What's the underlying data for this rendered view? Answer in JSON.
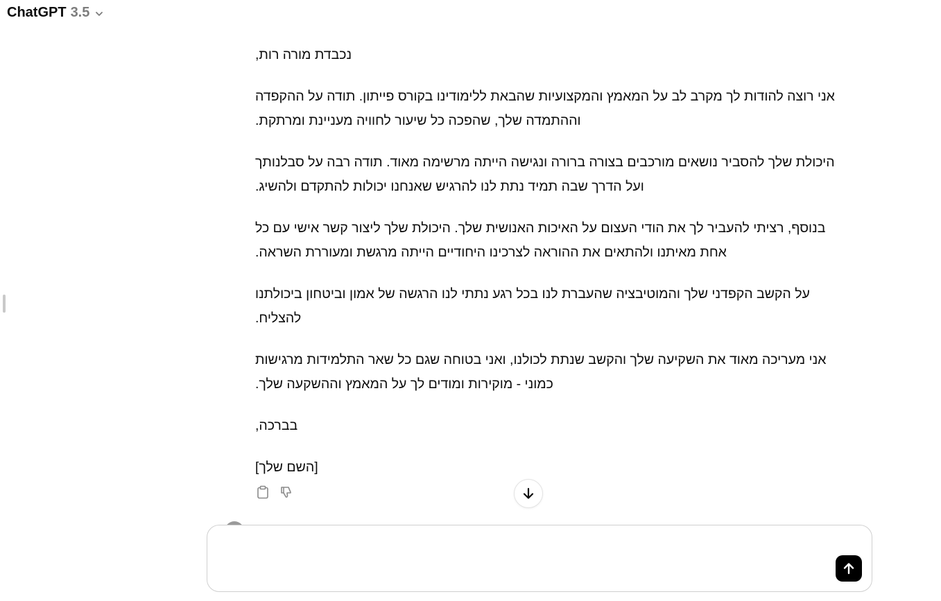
{
  "header": {
    "model_name": "ChatGPT",
    "model_version": "3.5",
    "chevron_icon": "chevron-down-icon"
  },
  "message": {
    "paragraphs": [
      ",נכבדת מורה רות",
      "אני רוצה להודות לך מקרב לב על המאמץ והמקצועיות שהבאת ללימודינו בקורס פייתון. תודה על ההקפדה",
      ".וההתמדה שלך, שהפכה כל שיעור לחוויה מעניינת ומרתקת",
      "היכולת שלך להסביר נושאים מורכבים בצורה ברורה ונגישה הייתה מרשימה מאוד. תודה רבה על סבלנותך",
      ".ועל הדרך שבה תמיד נתת לנו להרגיש שאנחנו יכולות להתקדם ולהשיג",
      "בנוסף, רציתי להעביר לך את הודי העצום על האיכות האנושית שלך. היכולת שלך ליצור קשר אישי עם כל",
      ".אחת מאיתנו ולהתאים את ההוראה לצרכינו היחודיים הייתה מרגשת ומעוררת השראה",
      "על הקשב הקפדני שלך והמוטיבציה שהעברת לנו בכל רגע נתתי לנו הרגשה של אמון וביטחון ביכולתנו",
      ".להצליח",
      "אני מעריכה מאוד את השקיעה שלך והקשב שנתת לכולנו, ואני בטוחה שגם כל שאר התלמידות מרגישות",
      ".כמוני - מוקירות ומודים לך על המאמץ וההשקעה שלך",
      ",בברכה",
      "[השם שלך]"
    ]
  },
  "actions": {
    "copy_icon": "clipboard-icon",
    "dislike_icon": "thumbs-down-icon"
  },
  "scroll": {
    "icon": "arrow-down-icon"
  },
  "composer": {
    "value": "",
    "placeholder": "",
    "send_icon": "arrow-up-icon"
  }
}
